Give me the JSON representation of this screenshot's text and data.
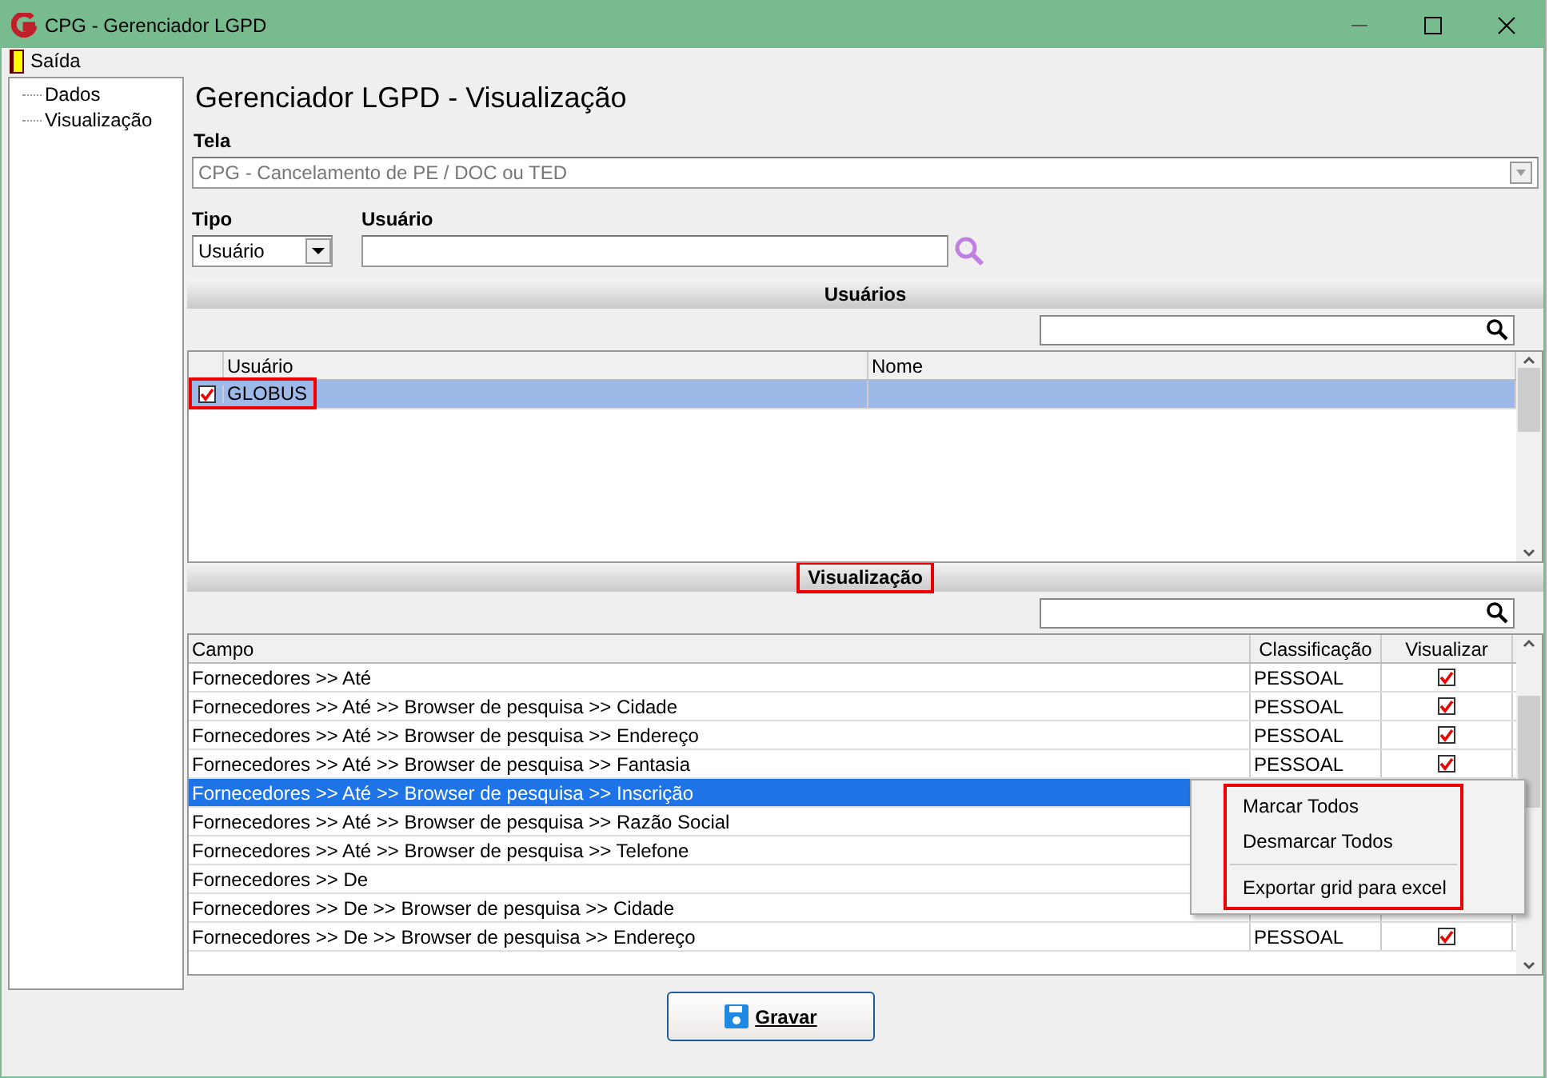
{
  "window": {
    "title": "CPG - Gerenciador LGPD"
  },
  "menu": [
    {
      "label": "Saída"
    }
  ],
  "tree": [
    {
      "label": "Dados"
    },
    {
      "label": "Visualização"
    }
  ],
  "page_title": "Gerenciador LGPD - Visualização",
  "tela": {
    "label": "Tela",
    "value": "CPG - Cancelamento de PE / DOC ou TED",
    "disabled": true
  },
  "tipo": {
    "label": "Tipo",
    "value": "Usuário"
  },
  "usuario": {
    "label": "Usuário"
  },
  "usuarios_section": {
    "title": "Usuários",
    "highlighted": false,
    "columns": [
      "Usuário",
      "Nome"
    ],
    "rows": [
      {
        "usuario": "GLOBUS",
        "checked": true,
        "selected": true,
        "highlighted": true
      }
    ]
  },
  "visualizacao_section": {
    "title": "Visualização",
    "highlighted": true,
    "columns": [
      "Campo",
      "Classificação",
      "Visualizar"
    ],
    "rows": [
      {
        "campo": "Fornecedores >> Até",
        "classificacao": "PESSOAL",
        "visualizar": true,
        "selected": false
      },
      {
        "campo": "Fornecedores >> Até >> Browser de pesquisa >> Cidade",
        "classificacao": "PESSOAL",
        "visualizar": true,
        "selected": false
      },
      {
        "campo": "Fornecedores >> Até >> Browser de pesquisa >> Endereço",
        "classificacao": "PESSOAL",
        "visualizar": true,
        "selected": false
      },
      {
        "campo": "Fornecedores >> Até >> Browser de pesquisa >> Fantasia",
        "classificacao": "PESSOAL",
        "visualizar": true,
        "selected": false
      },
      {
        "campo": "Fornecedores >> Até >> Browser de pesquisa >> Inscrição",
        "selected": true
      },
      {
        "campo": "Fornecedores >> Até >> Browser de pesquisa >> Razão Social",
        "selected": false
      },
      {
        "campo": "Fornecedores >> Até >> Browser de pesquisa >> Telefone",
        "selected": false
      },
      {
        "campo": "Fornecedores >> De",
        "selected": false
      },
      {
        "campo": "Fornecedores >> De >> Browser de pesquisa >> Cidade",
        "selected": false
      },
      {
        "campo": "Fornecedores >> De >> Browser de pesquisa >> Endereço",
        "classificacao": "PESSOAL",
        "visualizar": true,
        "selected": false
      }
    ]
  },
  "context_menu": {
    "highlighted": true,
    "items": [
      {
        "kind": "item",
        "label": "Marcar Todos"
      },
      {
        "kind": "item",
        "label": "Desmarcar Todos"
      },
      {
        "kind": "separator"
      },
      {
        "kind": "item",
        "label": "Exportar grid para excel"
      }
    ]
  },
  "buttons": [
    {
      "label": "Gravar"
    }
  ]
}
